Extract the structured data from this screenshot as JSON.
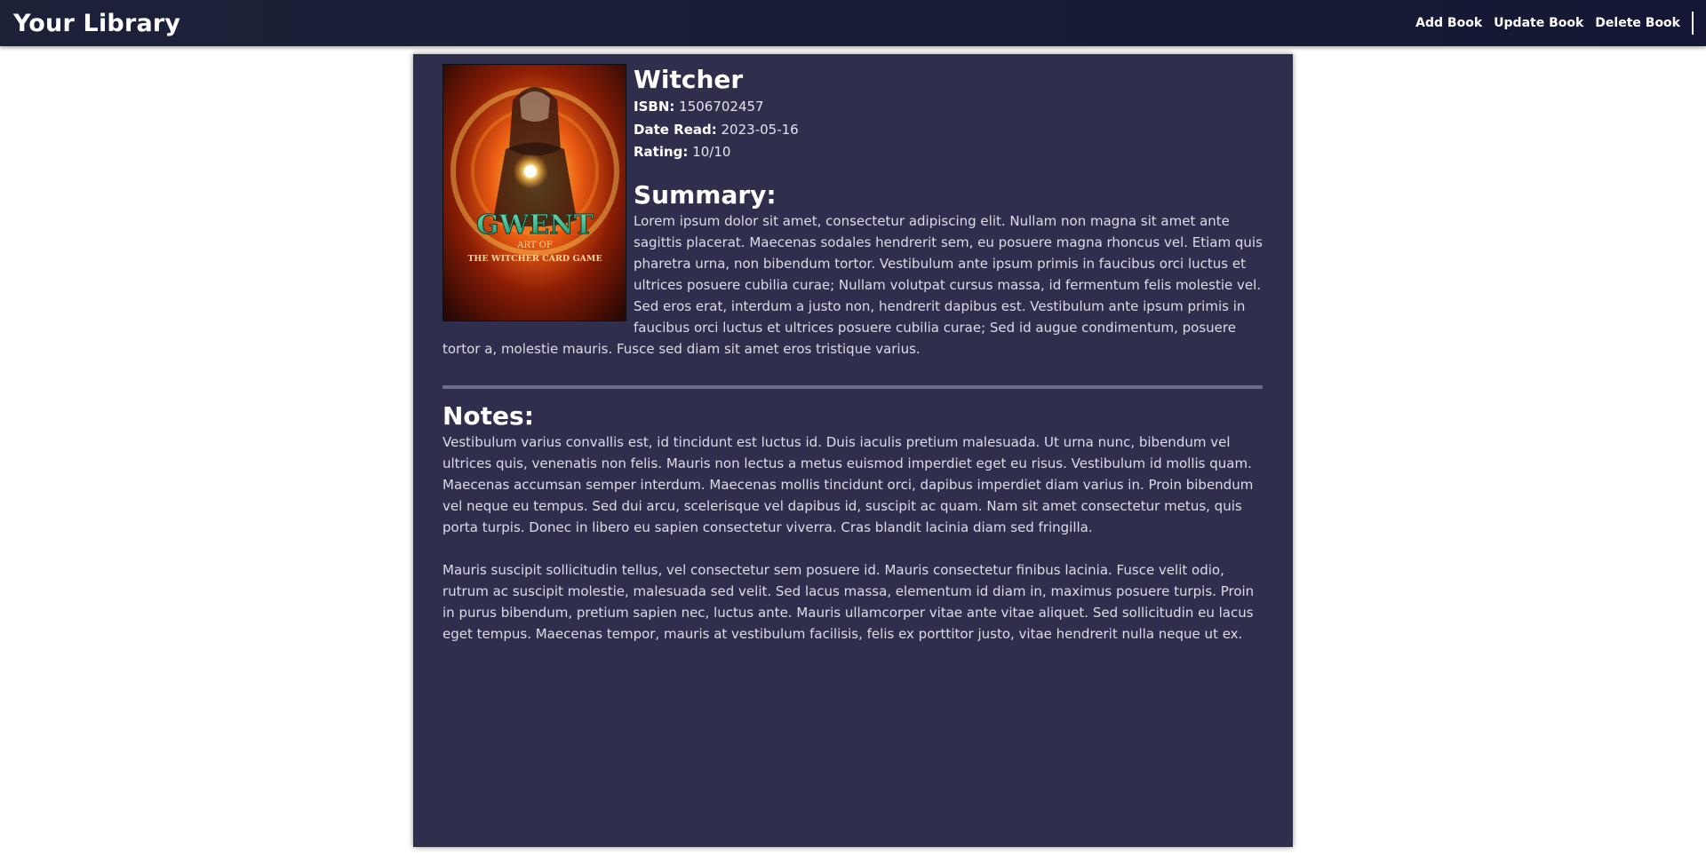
{
  "navbar": {
    "brand": "Your Library",
    "links": [
      {
        "label": "Add Book"
      },
      {
        "label": "Update Book"
      },
      {
        "label": "Delete Book"
      }
    ]
  },
  "book": {
    "title": "Witcher",
    "cover": {
      "alt": "Book cover",
      "text_line1": "GWENT",
      "text_line2": "ART OF",
      "text_line3": "THE WITCHER CARD GAME"
    },
    "isbn_label": "ISBN:",
    "isbn": "1506702457",
    "date_read_label": "Date Read:",
    "date_read": "2023-05-16",
    "rating_label": "Rating:",
    "rating": "10/10"
  },
  "summary": {
    "heading": "Summary:",
    "text": "Lorem ipsum dolor sit amet, consectetur adipiscing elit. Nullam non magna sit amet ante sagittis placerat. Maecenas sodales hendrerit sem, eu posuere magna rhoncus vel. Etiam quis pharetra urna, non bibendum tortor. Vestibulum ante ipsum primis in faucibus orci luctus et ultrices posuere cubilia curae; Nullam volutpat cursus massa, id fermentum felis molestie vel. Sed eros erat, interdum a justo non, hendrerit dapibus est. Vestibulum ante ipsum primis in faucibus orci luctus et ultrices posuere cubilia curae; Sed id augue condimentum, posuere tortor a, molestie mauris. Fusce sed diam sit amet eros tristique varius."
  },
  "notes": {
    "heading": "Notes:",
    "paragraphs": [
      "Vestibulum varius convallis est, id tincidunt est luctus id. Duis iaculis pretium malesuada. Ut urna nunc, bibendum vel ultrices quis, venenatis non felis. Mauris non lectus a metus euismod imperdiet eget eu risus. Vestibulum id mollis quam. Maecenas accumsan semper interdum. Maecenas mollis tincidunt orci, dapibus imperdiet diam varius in. Proin bibendum vel neque eu tempus. Sed dui arcu, scelerisque vel dapibus id, suscipit ac quam. Nam sit amet consectetur metus, quis porta turpis. Donec in libero eu sapien consectetur viverra. Cras blandit lacinia diam sed fringilla.",
      "Mauris suscipit sollicitudin tellus, vel consectetur sem posuere id. Mauris consectetur finibus lacinia. Fusce velit odio, rutrum ac suscipit molestie, malesuada sed velit. Sed lacus massa, elementum id diam in, maximus posuere turpis. Proin in purus bibendum, pretium sapien nec, luctus ante. Mauris ullamcorper vitae ante vitae aliquet. Sed sollicitudin eu lacus eget tempus. Maecenas tempor, mauris at vestibulum facilisis, felis ex porttitor justo, vitae hendrerit nulla neque ut ex."
    ]
  },
  "colors": {
    "navbar_bg": "#161a33",
    "card_bg": "#302e4d",
    "divider": "#6e6e8a",
    "text": "#dcdce6"
  }
}
